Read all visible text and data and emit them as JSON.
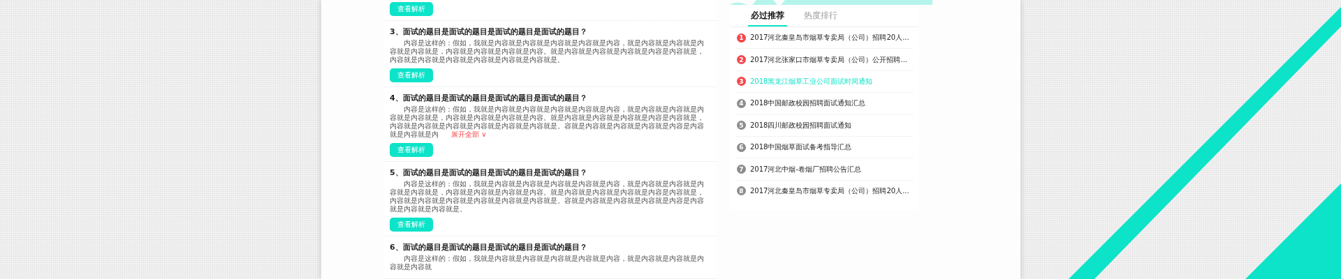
{
  "questions": [
    {
      "button": "查看解析"
    },
    {
      "title": "3、面试的题目是面试的题目是面试的题目是面试的题目？",
      "body": "内容是这样的：假如，我就是内容就是内容就是内容就是内容就是内容，就是内容就是内容就是内容就是内容就是，内容就是内容就是内容就是内容。就是内容就是内容就是内容就是内容是内容就是，内容就是内容就是内容就是内容就是内容就是内容就是。",
      "button": "查看解析"
    },
    {
      "title": "4、面试的题目是面试的题目是面试的题目是面试的题目？",
      "body": "内容是这样的：假如，我就是内容就是内容就是内容就是内容就是内容，就是内容就是内容就是内容就是内容就是，内容就是内容就是内容就是内容。就是内容就是内容就是内容就是内容是内容就是，内容就是内容就是内容就是内容就是内容就是内容就是。容就是内容就是内容就是内容就是内容是内容就是内容就是内",
      "expand_link": "展开全部 ∨",
      "button": "查看解析"
    },
    {
      "title": "5、面试的题目是面试的题目是面试的题目是面试的题目？",
      "body": "内容是这样的：假如，我就是内容就是内容就是内容就是内容就是内容，就是内容就是内容就是内容就是内容就是，内容就是内容就是内容就是内容。就是内容就是内容就是内容就是内容是内容就是，内容就是内容就是内容就是内容就是内容就是内容就是。容就是内容就是内容就是内容就是内容是内容就是内容就是内容就是。",
      "button": "查看解析"
    },
    {
      "title": "6、面试的题目是面试的题目是面试的题目是面试的题目？",
      "body": "内容是这样的：假如，我就是内容就是内容就是内容就是内容就是内容，就是内容就是内容就是内容就是内容就"
    }
  ],
  "sidebar": {
    "tabs": [
      {
        "label": "必过推荐",
        "selected": true
      },
      {
        "label": "热度排行",
        "selected": false
      }
    ],
    "items": [
      {
        "rank": "1",
        "title": "2017河北秦皇岛市烟草专卖局（公司）招聘20人...",
        "color": "#f5474c",
        "highlighted": false
      },
      {
        "rank": "2",
        "title": "2017河北张家口市烟草专卖局（公司）公开招聘...",
        "color": "#f5474c",
        "highlighted": false
      },
      {
        "rank": "3",
        "title": "2018黑龙江烟草工业公司面试时间通知",
        "color": "#f5474c",
        "highlighted": true
      },
      {
        "rank": "4",
        "title": "2018中国邮政校园招聘面试通知汇总",
        "color": "#8c8c8c",
        "highlighted": false
      },
      {
        "rank": "5",
        "title": "2018四川邮政校园招聘面试通知",
        "color": "#8c8c8c",
        "highlighted": false
      },
      {
        "rank": "6",
        "title": "2018中国烟草面试备考指导汇总",
        "color": "#8c8c8c",
        "highlighted": false
      },
      {
        "rank": "7",
        "title": "2017河北中烟-卷烟厂招聘公告汇总",
        "color": "#8c8c8c",
        "highlighted": false
      },
      {
        "rank": "8",
        "title": "2017河北秦皇岛市烟草专卖局（公司）招聘20人...",
        "color": "#8c8c8c",
        "highlighted": false
      }
    ]
  }
}
